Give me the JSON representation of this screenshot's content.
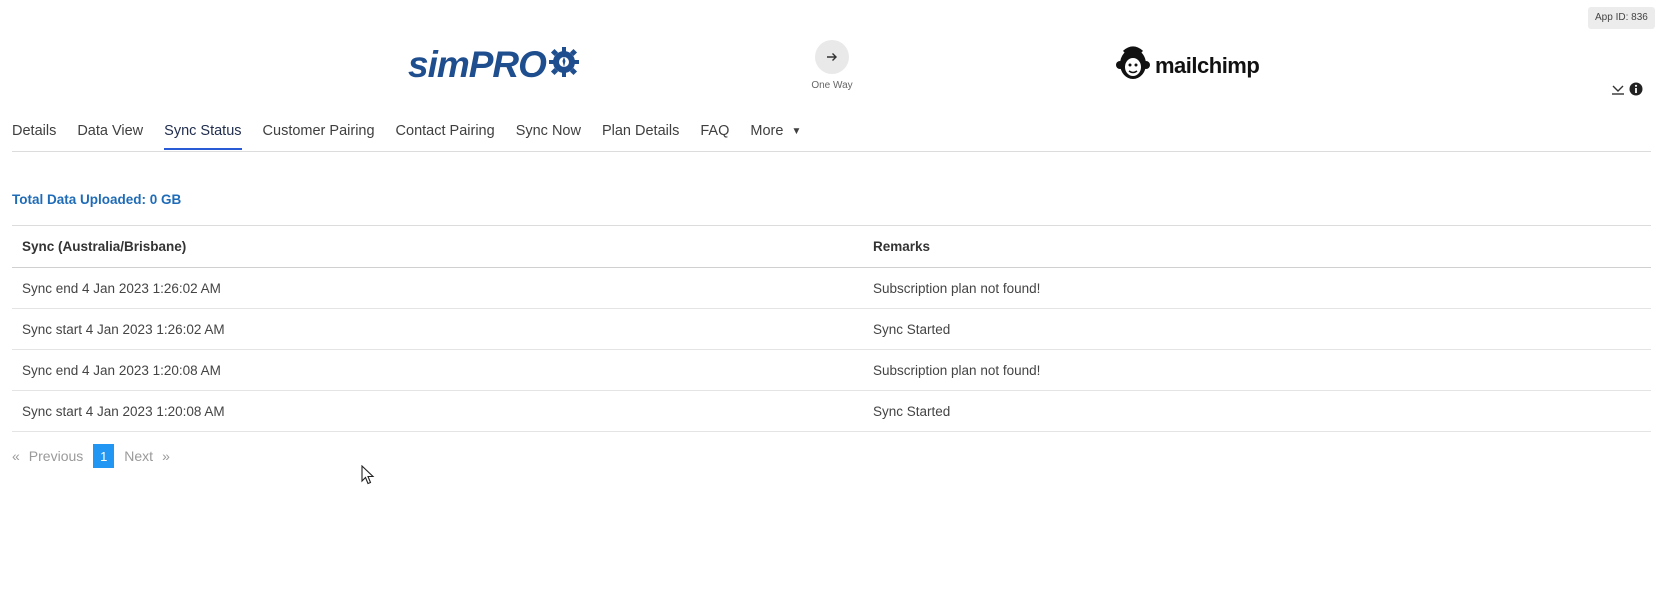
{
  "header": {
    "app_id": "App ID: 836",
    "source_logo": "simPRO",
    "direction_label": "One Way",
    "target_logo": "mailchimp"
  },
  "tabs": [
    {
      "label": "Details"
    },
    {
      "label": "Data View"
    },
    {
      "label": "Sync Status",
      "active": true
    },
    {
      "label": "Customer Pairing"
    },
    {
      "label": "Contact Pairing"
    },
    {
      "label": "Sync Now"
    },
    {
      "label": "Plan Details"
    },
    {
      "label": "FAQ"
    },
    {
      "label": "More"
    }
  ],
  "summary": {
    "total_uploaded": "Total Data Uploaded: 0 GB"
  },
  "table": {
    "columns": [
      "Sync (Australia/Brisbane)",
      "Remarks"
    ],
    "rows": [
      {
        "sync": "Sync end 4 Jan 2023 1:26:02 AM",
        "remarks": "Subscription plan not found!"
      },
      {
        "sync": "Sync start 4 Jan 2023 1:26:02 AM",
        "remarks": "Sync Started"
      },
      {
        "sync": "Sync end 4 Jan 2023 1:20:08 AM",
        "remarks": "Subscription plan not found!"
      },
      {
        "sync": "Sync start 4 Jan 2023 1:20:08 AM",
        "remarks": "Sync Started"
      }
    ]
  },
  "pagination": {
    "prev_symbol": "«",
    "prev_label": "Previous",
    "current_page": "1",
    "next_label": "Next",
    "next_symbol": "»"
  },
  "colors": {
    "accent": "#2a5bd7",
    "link_blue": "#1e6bb8",
    "page_active": "#2196f3",
    "simpro_blue": "#1f4e8f"
  },
  "icons": {
    "direction": "arrow-right-icon",
    "collapse": "collapse-icon",
    "info": "info-icon",
    "more_caret": "caret-down-icon"
  }
}
